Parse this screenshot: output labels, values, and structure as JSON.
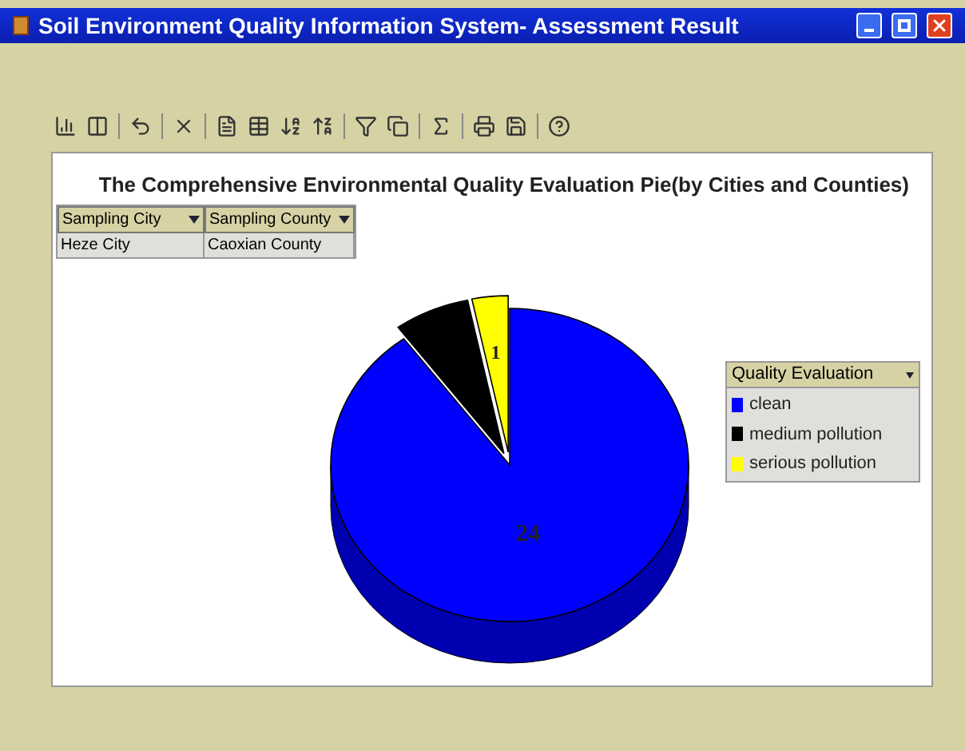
{
  "window": {
    "title": "Soil Environment Quality Information System- Assessment Result"
  },
  "report": {
    "title": "The Comprehensive Environmental Quality Evaluation Pie(by Cities and Counties)",
    "filters": {
      "columns": [
        "Sampling City",
        "Sampling County"
      ],
      "values": [
        "Heze City",
        "Caoxian County"
      ]
    },
    "pie_labels": [
      "24",
      "1"
    ],
    "legend": {
      "title": "Quality Evaluation",
      "items": [
        {
          "label": "clean",
          "color": "#0000ff"
        },
        {
          "label": "medium pollution",
          "color": "#000000"
        },
        {
          "label": "serious pollution",
          "color": "#ffff00"
        }
      ]
    }
  }
}
